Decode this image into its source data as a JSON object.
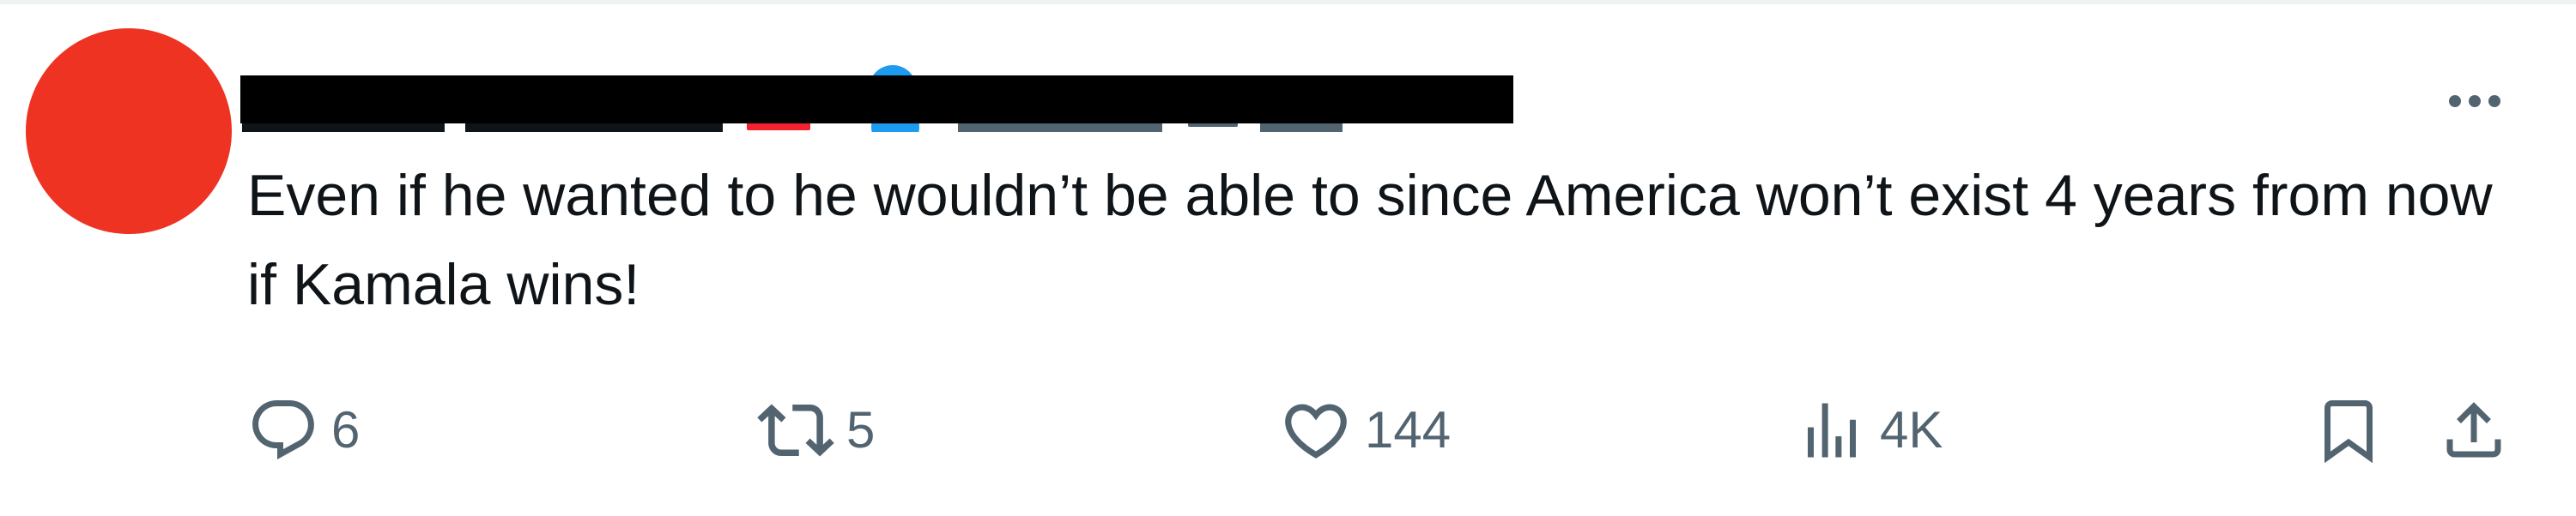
{
  "post": {
    "author": {
      "name_redacted": true,
      "handle_redacted": true,
      "verified": true
    },
    "text": "Even if he wanted to he wouldn’t be able to since America won’t exist 4 years from now if Kamala wins!",
    "more_icon": "ellipsis-icon",
    "actions": {
      "reply": {
        "icon": "reply-bubble-icon",
        "count": "6"
      },
      "repost": {
        "icon": "repost-arrows-icon",
        "count": "5"
      },
      "like": {
        "icon": "heart-icon",
        "count": "144"
      },
      "views": {
        "icon": "bar-chart-icon",
        "count": "4K"
      },
      "bookmark": {
        "icon": "bookmark-icon"
      },
      "share": {
        "icon": "share-upload-icon"
      }
    }
  },
  "colors": {
    "avatar": "#ee3322",
    "text": "#0f1419",
    "secondary": "#536471",
    "verified": "#1d9bf0",
    "redaction": "#000000"
  }
}
